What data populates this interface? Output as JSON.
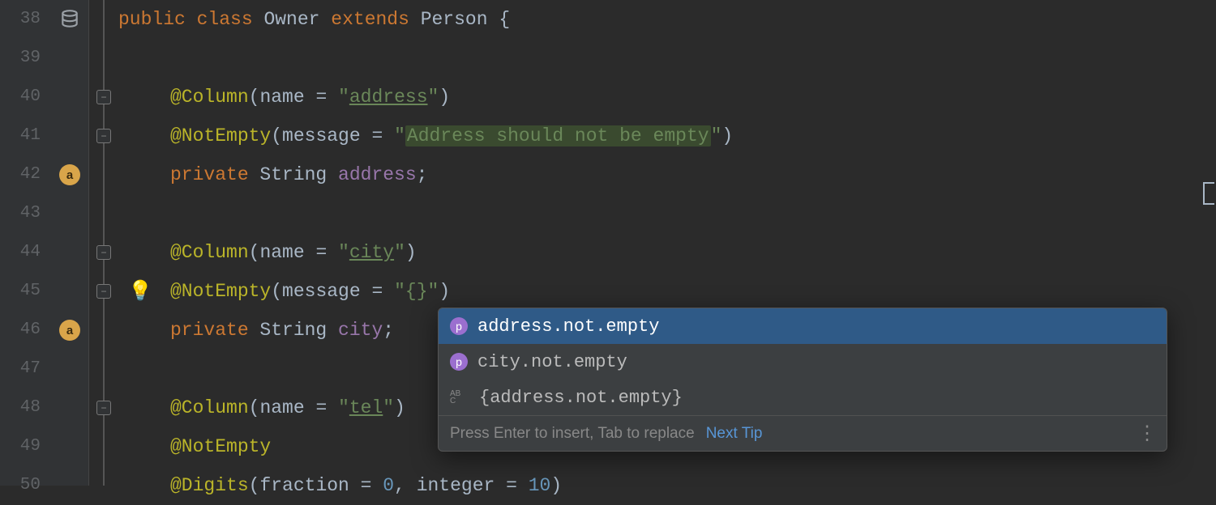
{
  "lines": [
    {
      "num": "38",
      "gutterIcon": "database"
    },
    {
      "num": "39"
    },
    {
      "num": "40",
      "fold": true
    },
    {
      "num": "41",
      "fold": true
    },
    {
      "num": "42",
      "gutterIcon": "a-badge"
    },
    {
      "num": "43"
    },
    {
      "num": "44",
      "fold": true
    },
    {
      "num": "45",
      "fold": true,
      "bulb": true
    },
    {
      "num": "46",
      "gutterIcon": "a-badge"
    },
    {
      "num": "47"
    },
    {
      "num": "48",
      "fold": true
    },
    {
      "num": "49"
    },
    {
      "num": "50"
    }
  ],
  "code": {
    "l38": {
      "kw_public": "public ",
      "kw_class": "class ",
      "name": "Owner ",
      "kw_extends": "extends ",
      "parent": "Person ",
      "brace": "{"
    },
    "l40": {
      "annot": "@Column",
      "open": "(",
      "param": "name = ",
      "q1": "\"",
      "val": "address",
      "q2": "\"",
      "close": ")"
    },
    "l41": {
      "annot": "@NotEmpty",
      "open": "(",
      "param": "message = ",
      "q1": "\"",
      "val": "Address should not be empty",
      "q2": "\"",
      "close": ")"
    },
    "l42": {
      "kw": "private ",
      "type": "String ",
      "field": "address",
      "semi": ";"
    },
    "l44": {
      "annot": "@Column",
      "open": "(",
      "param": "name = ",
      "q1": "\"",
      "val": "city",
      "q2": "\"",
      "close": ")"
    },
    "l45": {
      "annot": "@NotEmpty",
      "open": "(",
      "param": "message = ",
      "q1": "\"",
      "val": "{}",
      "q2": "\"",
      "close": ")"
    },
    "l46": {
      "kw": "private ",
      "type": "String ",
      "field": "city",
      "semi": ";"
    },
    "l48": {
      "annot": "@Column",
      "open": "(",
      "param": "name = ",
      "q1": "\"",
      "val": "tel",
      "q2": "\"",
      "close": ")"
    },
    "l49": {
      "annot": "@NotEmpty"
    },
    "l50": {
      "annot": "@Digits",
      "open": "(",
      "p1": "fraction = ",
      "v1": "0",
      "comma": ", ",
      "p2": "integer = ",
      "v2": "10",
      "close": ")"
    }
  },
  "popup": {
    "items": [
      {
        "icon": "p",
        "text": "address.not.empty",
        "selected": true
      },
      {
        "icon": "p",
        "text": "city.not.empty",
        "selected": false
      },
      {
        "icon": "abc",
        "text": "{address.not.empty}",
        "selected": false
      }
    ],
    "hint": "Press Enter to insert, Tab to replace",
    "nextTip": "Next Tip"
  }
}
